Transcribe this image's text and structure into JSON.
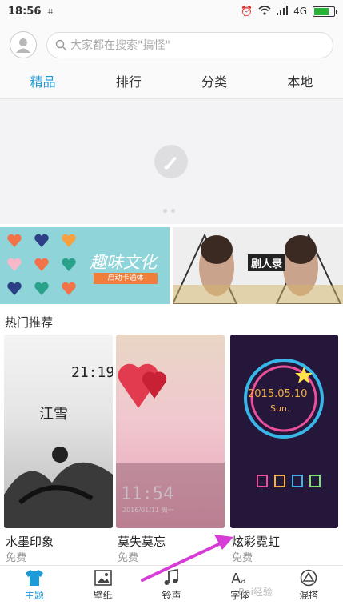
{
  "status_bar": {
    "time": "18:56",
    "network": "4G"
  },
  "search": {
    "placeholder": "大家都在搜索\"搞怪\""
  },
  "tabs": [
    {
      "label": "精品",
      "active": true
    },
    {
      "label": "排行"
    },
    {
      "label": "分类"
    },
    {
      "label": "本地"
    }
  ],
  "promos": [
    {
      "title": "趣味文化",
      "subtitle": "启动卡通体"
    },
    {
      "title": "剧人录"
    }
  ],
  "section": {
    "title": "热门推荐"
  },
  "themes": [
    {
      "name": "水墨印象",
      "price": "免费",
      "overlay_text": "21:19",
      "caption": "江雪"
    },
    {
      "name": "莫失莫忘",
      "price": "免费",
      "overlay_text": "11:54",
      "caption": "2016/01/11 周一"
    },
    {
      "name": "炫彩霓虹",
      "price": "免费",
      "overlay_text": "2015.05.10",
      "caption": "Sun."
    }
  ],
  "bottom_nav": [
    {
      "label": "主题",
      "icon": "tshirt-icon",
      "active": true
    },
    {
      "label": "壁纸",
      "icon": "image-icon"
    },
    {
      "label": "铃声",
      "icon": "music-note-icon"
    },
    {
      "label": "字体",
      "icon": "font-icon"
    },
    {
      "label": "混搭",
      "icon": "mix-icon"
    }
  ],
  "watermark": "Bai经验",
  "colors": {
    "accent": "#1e9ad8",
    "annotation_arrow": "#d63cd6"
  },
  "battery_level": 0.8
}
